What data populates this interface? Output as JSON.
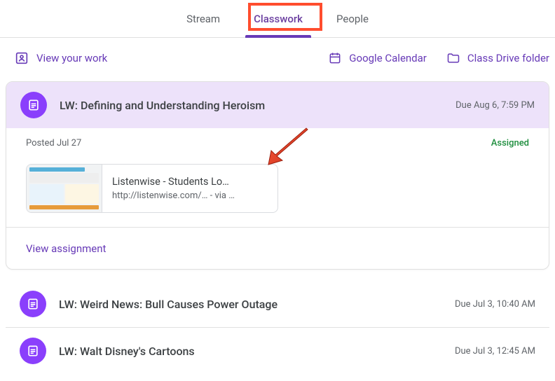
{
  "tabs": {
    "stream": "Stream",
    "classwork": "Classwork",
    "people": "People"
  },
  "toolbar": {
    "viewWork": "View your work",
    "calendar": "Google Calendar",
    "driveFolder": "Class Drive folder"
  },
  "assignment": {
    "title": "LW: Defining and Understanding Heroism",
    "due": "Due Aug 6, 7:59 PM",
    "posted": "Posted Jul 27",
    "status": "Assigned",
    "attachment": {
      "title": "Listenwise - Students Lo…",
      "url": "http://listenwise.com/…  - via …"
    },
    "viewLink": "View assignment"
  },
  "upcoming": [
    {
      "title": "LW: Weird News: Bull Causes Power Outage",
      "due": "Due Jul 3, 10:40 AM"
    },
    {
      "title": "LW: Walt Disney's Cartoons",
      "due": "Due Jul 3, 12:45 AM"
    }
  ]
}
